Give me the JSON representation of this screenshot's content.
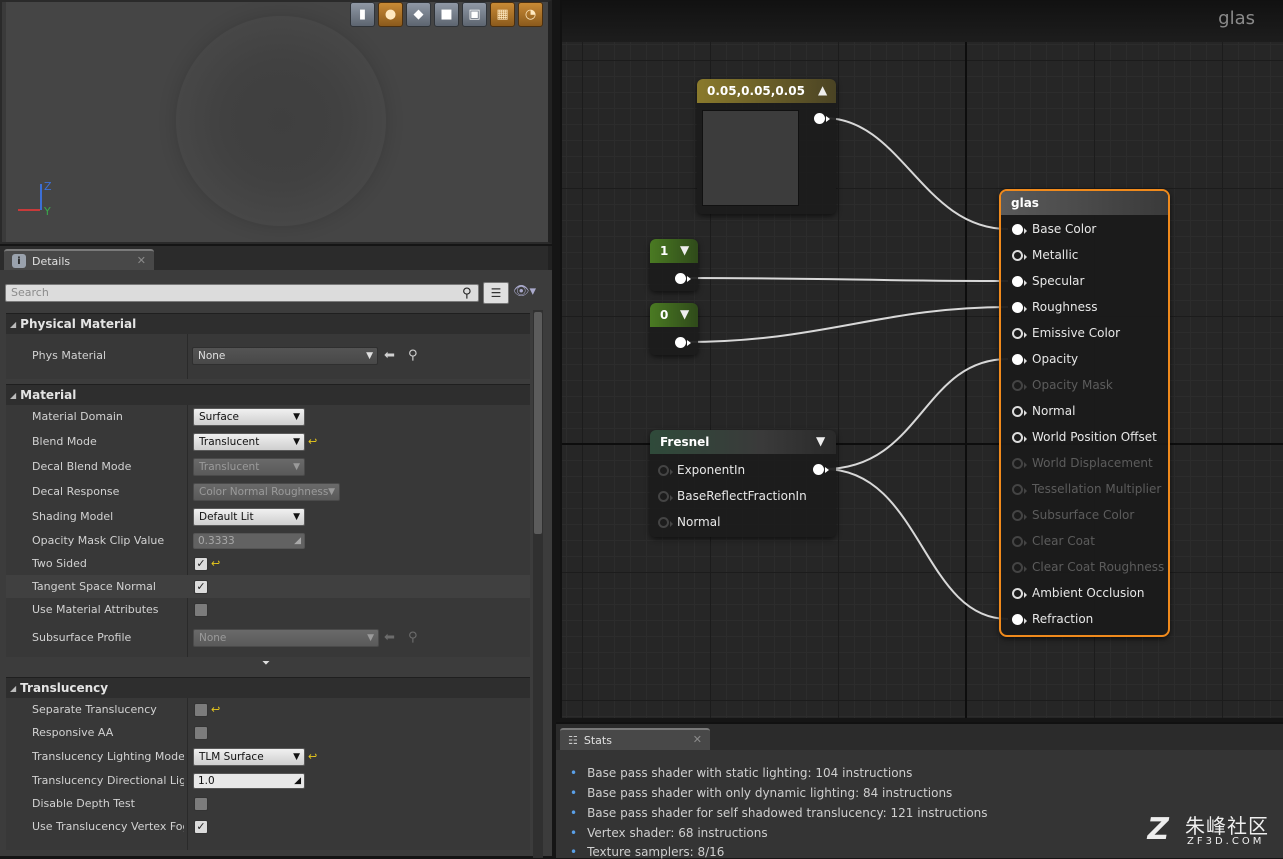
{
  "viewport": {
    "toolbar_buttons": [
      {
        "icon": "cylinder-icon",
        "style": "gray"
      },
      {
        "icon": "sphere-icon",
        "style": "orange"
      },
      {
        "icon": "plane-icon",
        "style": "gray"
      },
      {
        "icon": "cube-icon",
        "style": "gray"
      },
      {
        "icon": "mesh-icon",
        "style": "gray"
      },
      {
        "icon": "grid-icon",
        "style": "orange"
      },
      {
        "icon": "realtime-icon",
        "style": "orange"
      }
    ],
    "axis_z": "Z",
    "axis_y": "Y"
  },
  "details": {
    "tab_label": "Details",
    "search_placeholder": "Search",
    "sections": {
      "physical_material": {
        "title": "Physical Material",
        "phys_material_label": "Phys Material",
        "phys_material_value": "None"
      },
      "material": {
        "title": "Material",
        "rows": [
          {
            "label": "Material Domain",
            "value": "Surface"
          },
          {
            "label": "Blend Mode",
            "value": "Translucent"
          },
          {
            "label": "Decal Blend Mode",
            "value": "Translucent"
          },
          {
            "label": "Decal Response",
            "value": "Color Normal Roughness"
          },
          {
            "label": "Shading Model",
            "value": "Default Lit"
          },
          {
            "label": "Opacity Mask Clip Value",
            "value": "0.3333"
          },
          {
            "label": "Two Sided",
            "checked": true
          },
          {
            "label": "Tangent Space Normal",
            "checked": true
          },
          {
            "label": "Use Material Attributes",
            "checked": false
          },
          {
            "label": "Subsurface Profile",
            "value": "None"
          }
        ]
      },
      "translucency": {
        "title": "Translucency",
        "rows": [
          {
            "label": "Separate Translucency",
            "checked": false
          },
          {
            "label": "Responsive AA",
            "checked": false
          },
          {
            "label": "Translucency Lighting Mode",
            "value": "TLM Surface"
          },
          {
            "label": "Translucency Directional Lighti",
            "value": "1.0"
          },
          {
            "label": "Disable Depth Test",
            "checked": false
          },
          {
            "label": "Use Translucency Vertex Fog",
            "checked": true
          }
        ]
      }
    }
  },
  "graph": {
    "title": "glas",
    "constant3": {
      "header": "0.05,0.05,0.05",
      "swatch_color": "#3c3c3c"
    },
    "const_specular": {
      "header": "1"
    },
    "const_roughness": {
      "header": "0"
    },
    "fresnel": {
      "header": "Fresnel",
      "inputs": [
        "ExponentIn",
        "BaseReflectFractionIn",
        "Normal"
      ]
    },
    "result_node": {
      "header": "glas",
      "inputs": [
        {
          "label": "Base Color",
          "state": "connected"
        },
        {
          "label": "Metallic",
          "state": "open"
        },
        {
          "label": "Specular",
          "state": "connected"
        },
        {
          "label": "Roughness",
          "state": "connected"
        },
        {
          "label": "Emissive Color",
          "state": "open"
        },
        {
          "label": "Opacity",
          "state": "connected"
        },
        {
          "label": "Opacity Mask",
          "state": "disabled"
        },
        {
          "label": "Normal",
          "state": "open"
        },
        {
          "label": "World Position Offset",
          "state": "open"
        },
        {
          "label": "World Displacement",
          "state": "disabled"
        },
        {
          "label": "Tessellation Multiplier",
          "state": "disabled"
        },
        {
          "label": "Subsurface Color",
          "state": "disabled"
        },
        {
          "label": "Clear Coat",
          "state": "disabled"
        },
        {
          "label": "Clear Coat Roughness",
          "state": "disabled"
        },
        {
          "label": "Ambient Occlusion",
          "state": "open"
        },
        {
          "label": "Refraction",
          "state": "connected"
        }
      ]
    }
  },
  "stats": {
    "tab_label": "Stats",
    "lines": [
      "Base pass shader with static lighting: 104 instructions",
      "Base pass shader with only dynamic lighting: 84 instructions",
      "Base pass shader for self shadowed translucency: 121 instructions",
      "Vertex shader: 68 instructions",
      "Texture samplers: 8/16"
    ]
  },
  "watermark": {
    "logo": "Z",
    "cn": "朱峰社区",
    "en": "ZF3D.COM"
  },
  "colors": {
    "accent_selected": "#f08a1c",
    "vector_header": "#8a7a2c",
    "scalar_header": "#4a7a22",
    "function_header": "#2f4a3a"
  }
}
